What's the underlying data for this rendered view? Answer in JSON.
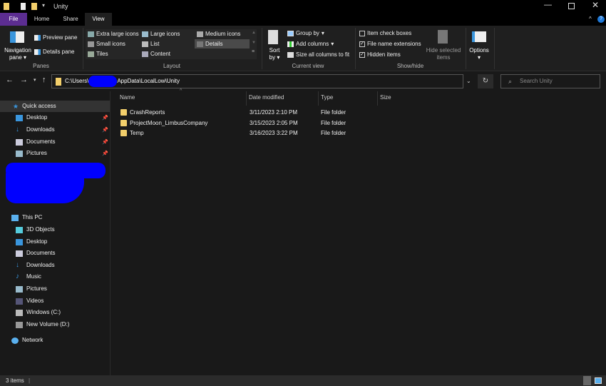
{
  "window": {
    "title": "Unity"
  },
  "tabs": [
    "File",
    "Home",
    "Share",
    "View"
  ],
  "ribbon": {
    "panes": {
      "navigation_pane": "Navigation",
      "navigation_pane2": "pane",
      "preview_pane": "Preview pane",
      "details_pane": "Details pane",
      "label": "Panes"
    },
    "layout": {
      "items": [
        "Extra large icons",
        "Large icons",
        "Medium icons",
        "Small icons",
        "List",
        "Details",
        "Tiles",
        "Content"
      ],
      "selected": "Details",
      "label": "Layout"
    },
    "current_view": {
      "sort_by": "Sort",
      "sort_by2": "by",
      "group_by": "Group by",
      "add_columns": "Add columns",
      "size_columns": "Size all columns to fit",
      "label": "Current view"
    },
    "show_hide": {
      "item_check_boxes": "Item check boxes",
      "file_name_extensions": "File name extensions",
      "hidden_items": "Hidden items",
      "hide_selected": "Hide selected",
      "hide_selected2": "items",
      "label": "Show/hide",
      "checks": {
        "item_check_boxes": false,
        "file_name_extensions": true,
        "hidden_items": true
      }
    },
    "options": "Options"
  },
  "address": {
    "path_prefix": "C:\\Users\\",
    "path_suffix": "AppData\\LocalLow\\Unity",
    "search_placeholder": "Search Unity"
  },
  "nav": {
    "quick_access": "Quick access",
    "quick_items": [
      "Desktop",
      "Downloads",
      "Documents",
      "Pictures"
    ],
    "this_pc": "This PC",
    "pc_items": [
      "3D Objects",
      "Desktop",
      "Documents",
      "Downloads",
      "Music",
      "Pictures",
      "Videos",
      "Windows (C:)",
      "New Volume (D:)"
    ],
    "network": "Network"
  },
  "columns": [
    "Name",
    "Date modified",
    "Type",
    "Size"
  ],
  "files": [
    {
      "name": "CrashReports",
      "date": "3/11/2023 2:10 PM",
      "type": "File folder"
    },
    {
      "name": "ProjectMoon_LimbusCompany",
      "date": "3/15/2023 2:05 PM",
      "type": "File folder"
    },
    {
      "name": "Temp",
      "date": "3/16/2023 3:22 PM",
      "type": "File folder"
    }
  ],
  "status": {
    "count": "3 items"
  },
  "colors": {
    "file_tab": "#5c2d91",
    "accent": "#3a96dd",
    "folder": "#f3cf6b",
    "redaction": "#0000ff"
  }
}
